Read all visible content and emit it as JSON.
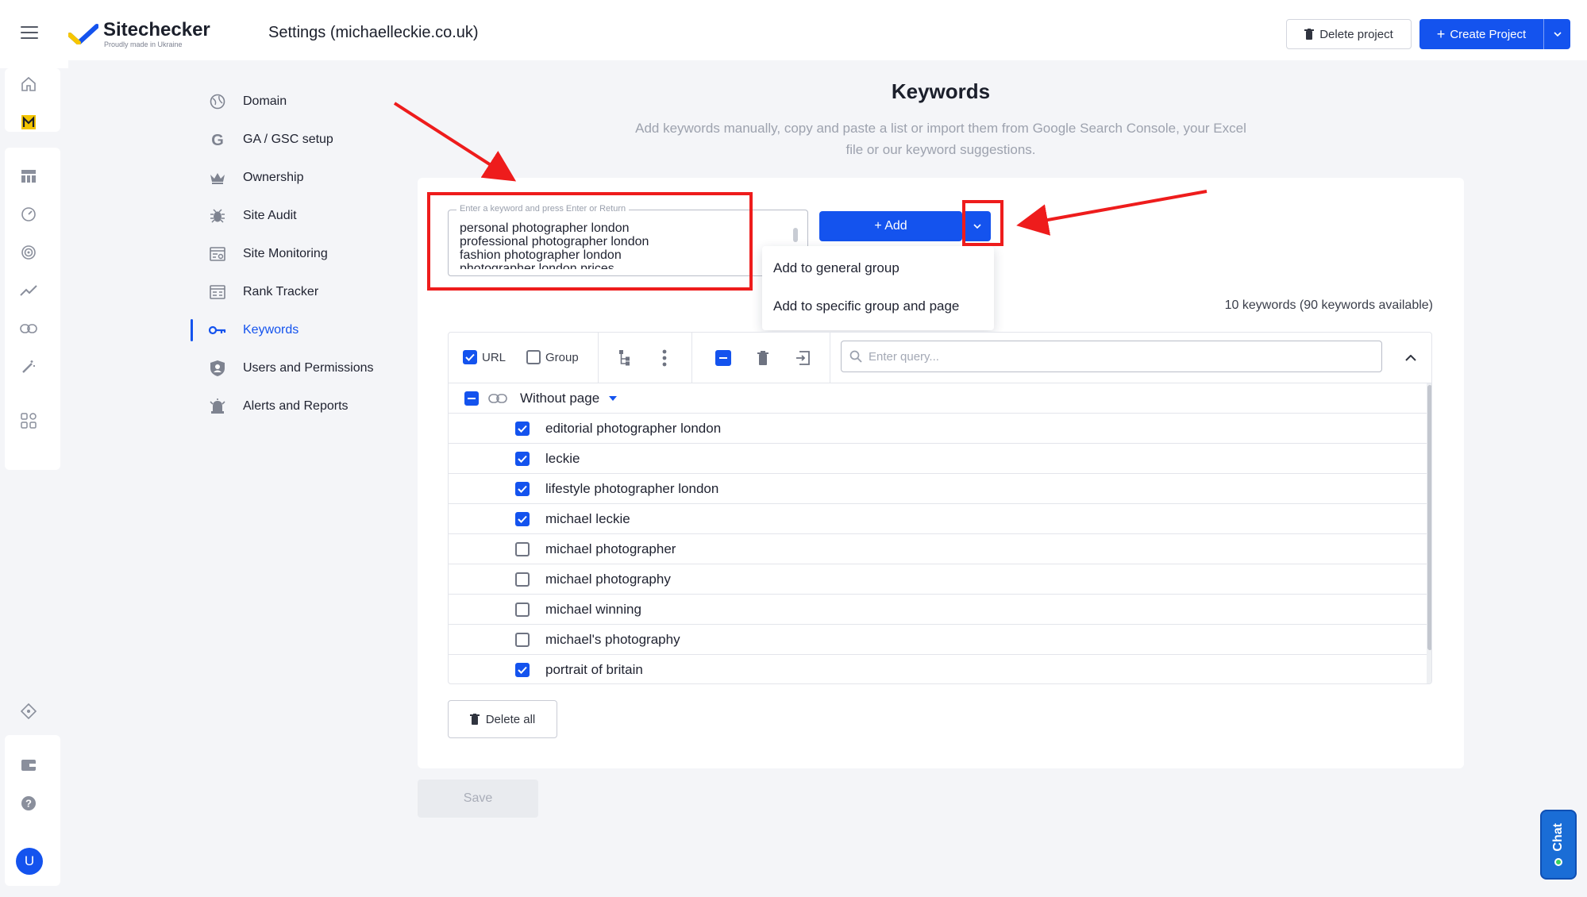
{
  "app": {
    "brand_name": "Sitechecker",
    "brand_tagline": "Proudly made in Ukraine",
    "page_title": "Settings (michaelleckie.co.uk)"
  },
  "header": {
    "delete_project_label": "Delete project",
    "create_project_label": "Create Project"
  },
  "left_rail": {
    "icons": [
      "home-icon",
      "project-logo-icon",
      "dashboard-icon",
      "speed-icon",
      "target-icon",
      "trend-icon",
      "link-icon",
      "magic-wand-icon",
      "apps-icon",
      "diamond-icon",
      "wallet-icon",
      "help-icon"
    ],
    "avatar_letter": "U"
  },
  "settings_nav": {
    "items": [
      {
        "label": "Domain",
        "icon": "globe-icon"
      },
      {
        "label": "GA / GSC setup",
        "icon": "google-icon"
      },
      {
        "label": "Ownership",
        "icon": "crown-icon"
      },
      {
        "label": "Site Audit",
        "icon": "bug-icon"
      },
      {
        "label": "Site Monitoring",
        "icon": "monitoring-icon"
      },
      {
        "label": "Rank Tracker",
        "icon": "rank-tracker-icon"
      },
      {
        "label": "Keywords",
        "icon": "key-icon",
        "active": true
      },
      {
        "label": "Users and Permissions",
        "icon": "shield-user-icon"
      },
      {
        "label": "Alerts and Reports",
        "icon": "alarm-icon"
      }
    ]
  },
  "keywords": {
    "title": "Keywords",
    "subtitle": "Add keywords manually, copy and paste a list or import them from Google Search Console, your Excel file or our keyword suggestions.",
    "input_legend": "Enter a keyword and press Enter or Return",
    "input_value": "personal photographer london\nprofessional photographer london\nfashion photographer london\nphotographer london prices",
    "add_label": "+ Add",
    "dropdown_options": [
      "Add to general group",
      "Add to specific group and page"
    ],
    "count_text": "10 keywords (90 keywords available)"
  },
  "table": {
    "toolbar": {
      "url_label": "URL",
      "url_checked": true,
      "group_label": "Group",
      "group_checked": false,
      "search_placeholder": "Enter query..."
    },
    "group": {
      "label": "Without page"
    },
    "rows": [
      {
        "text": "editorial photographer london",
        "checked": true
      },
      {
        "text": "leckie",
        "checked": true
      },
      {
        "text": "lifestyle photographer london",
        "checked": true
      },
      {
        "text": "michael leckie",
        "checked": true
      },
      {
        "text": "michael photographer",
        "checked": false
      },
      {
        "text": "michael photography",
        "checked": false
      },
      {
        "text": "michael winning",
        "checked": false
      },
      {
        "text": "michael's photography",
        "checked": false
      },
      {
        "text": "portrait of britain",
        "checked": true
      }
    ]
  },
  "actions": {
    "delete_all_label": "Delete all",
    "save_label": "Save"
  },
  "chat": {
    "label": "Chat"
  },
  "colors": {
    "accent": "#1453ee",
    "annotation": "#ee1c1c",
    "online": "#37d35e"
  }
}
